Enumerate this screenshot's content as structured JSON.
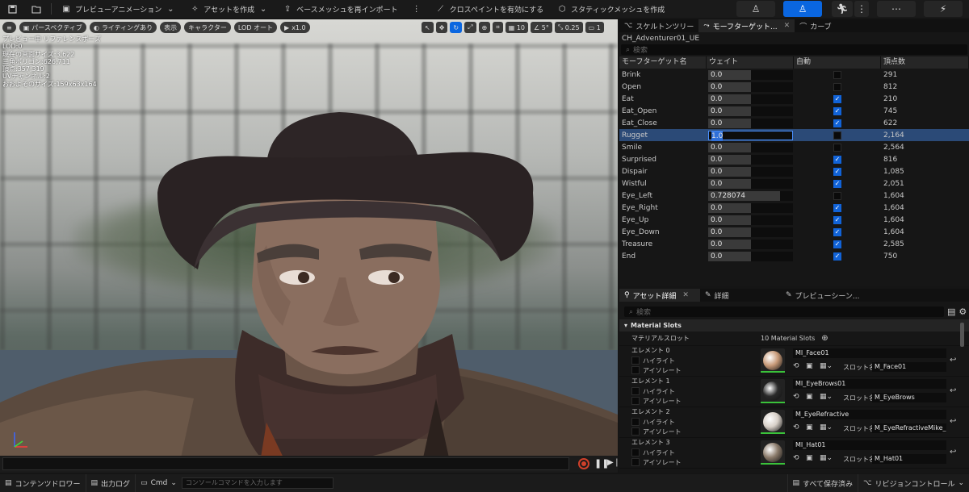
{
  "toolbar": {
    "preview_anim": "プレビューアニメーション",
    "create_asset": "アセットを作成",
    "reimport_base": "ベースメッシュを再インポート",
    "cloth_paint": "クロスペイントを有効にする",
    "static_mesh": "スタティックメッシュを作成"
  },
  "viewport": {
    "chips": [
      "パースペクティブ",
      "ライティングあり",
      "表示",
      "キャラクター",
      "LOD オート",
      "x1.0"
    ],
    "right_chips": [
      "10",
      "5°",
      "0.25",
      "1"
    ],
    "info": [
      "プレビュー中 リファレンスポーズ",
      "LOD:0",
      "現在の画面サイズ:3.622",
      "三角ポリゴン:626,711",
      "頂点:357,319",
      "UVチャンネル:2",
      "おおよそのサイズ:159x63x164"
    ]
  },
  "top_panel": {
    "tabs": [
      "スケルトンツリー",
      "モーフターゲット...",
      "カーブ"
    ],
    "asset_name": "CH_Adventurer01_UE",
    "search_placeholder": "検索",
    "columns": [
      "モーフターゲット名",
      "ウェイト",
      "自動",
      "頂点数"
    ],
    "rows": [
      {
        "name": "Brink",
        "weight": "0.0",
        "fill": 0.5,
        "auto": false,
        "verts": "291"
      },
      {
        "name": "Open",
        "weight": "0.0",
        "fill": 0.5,
        "auto": false,
        "verts": "812"
      },
      {
        "name": "Eat",
        "weight": "0.0",
        "fill": 0.5,
        "auto": true,
        "verts": "210"
      },
      {
        "name": "Eat_Open",
        "weight": "0.0",
        "fill": 0.5,
        "auto": true,
        "verts": "745"
      },
      {
        "name": "Eat_Close",
        "weight": "0.0",
        "fill": 0.5,
        "auto": true,
        "verts": "622"
      },
      {
        "name": "Rugget",
        "weight": "1.0",
        "fill": 0.0,
        "auto": false,
        "verts": "2,164",
        "selected": true
      },
      {
        "name": "Smile",
        "weight": "0.0",
        "fill": 0.5,
        "auto": false,
        "verts": "2,564"
      },
      {
        "name": "Surprised",
        "weight": "0.0",
        "fill": 0.5,
        "auto": true,
        "verts": "816"
      },
      {
        "name": "Dispair",
        "weight": "0.0",
        "fill": 0.5,
        "auto": true,
        "verts": "1,085"
      },
      {
        "name": "Wistful",
        "weight": "0.0",
        "fill": 0.5,
        "auto": true,
        "verts": "2,051"
      },
      {
        "name": "Eye_Left",
        "weight": "0.728074",
        "fill": 0.85,
        "auto": false,
        "verts": "1,604"
      },
      {
        "name": "Eye_Right",
        "weight": "0.0",
        "fill": 0.5,
        "auto": true,
        "verts": "1,604"
      },
      {
        "name": "Eye_Up",
        "weight": "0.0",
        "fill": 0.5,
        "auto": true,
        "verts": "1,604"
      },
      {
        "name": "Eye_Down",
        "weight": "0.0",
        "fill": 0.5,
        "auto": true,
        "verts": "1,604"
      },
      {
        "name": "Treasure",
        "weight": "0.0",
        "fill": 0.5,
        "auto": true,
        "verts": "2,585"
      },
      {
        "name": "End",
        "weight": "0.0",
        "fill": 0.5,
        "auto": true,
        "verts": "750"
      }
    ]
  },
  "details": {
    "tabs": [
      "アセット詳細",
      "詳細",
      "プレビューシーン..."
    ],
    "search_placeholder": "検索",
    "section": "Material Slots",
    "slot_label": "マテリアルスロット",
    "slot_count": "10 Material Slots",
    "highlight": "ハイライト",
    "isolate": "アイソレート",
    "slot_name_label": "スロット名",
    "elements": [
      {
        "label": "エレメント 0",
        "material": "MI_Face01",
        "slot": "M_Face01",
        "color": "#c89a78"
      },
      {
        "label": "エレメント 1",
        "material": "MI_EyeBrows01",
        "slot": "M_EyeBrows",
        "color": "#2a2a2a"
      },
      {
        "label": "エレメント 2",
        "material": "M_EyeRefractive",
        "slot": "M_EyeRefractiveMike_R_Ins",
        "color": "#d8d0c8"
      },
      {
        "label": "エレメント 3",
        "material": "MI_Hat01",
        "slot": "M_Hat01",
        "color": "#8a7a6a"
      }
    ]
  },
  "statusbar": {
    "content_drawer": "コンテンツドロワー",
    "output_log": "出力ログ",
    "cmd": "Cmd",
    "console_placeholder": "コンソールコマンドを入力します",
    "save_all": "すべて保存済み",
    "revision": "リビジョンコントロール"
  }
}
